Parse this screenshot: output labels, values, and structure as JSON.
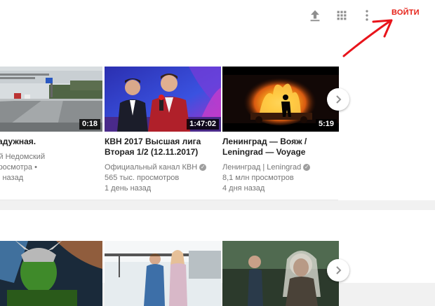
{
  "header": {
    "upload_icon": "upload-icon",
    "apps_icon": "apps-grid-icon",
    "more_icon": "more-vert-icon",
    "login_label": "ВОЙТИ"
  },
  "colors": {
    "accent": "#e62117",
    "annotation": "#e8141b",
    "page_bg": "#f1f1f1"
  },
  "shelf1": {
    "videos": [
      {
        "title_lines": [
          "т Радужная."
        ],
        "channel": "ерий Недомский",
        "views": "с. просмотра •",
        "age": "елю назад",
        "duration": "0:18",
        "verified": false
      },
      {
        "title_lines": [
          "КВН 2017 Высшая лига",
          "Вторая 1/2 (12.11.2017)"
        ],
        "channel": "Официальный канал КВН",
        "views": "565 тыс. просмотров",
        "age": "1 день назад",
        "duration": "1:47:02",
        "verified": true
      },
      {
        "title_lines": [
          "Ленинград — Вояж /",
          "Leningrad — Voyage"
        ],
        "channel": "Ленинград | Leningrad",
        "views": "8,1 млн просмотров",
        "age": "4 дня назад",
        "duration": "5:19",
        "verified": true
      }
    ]
  }
}
